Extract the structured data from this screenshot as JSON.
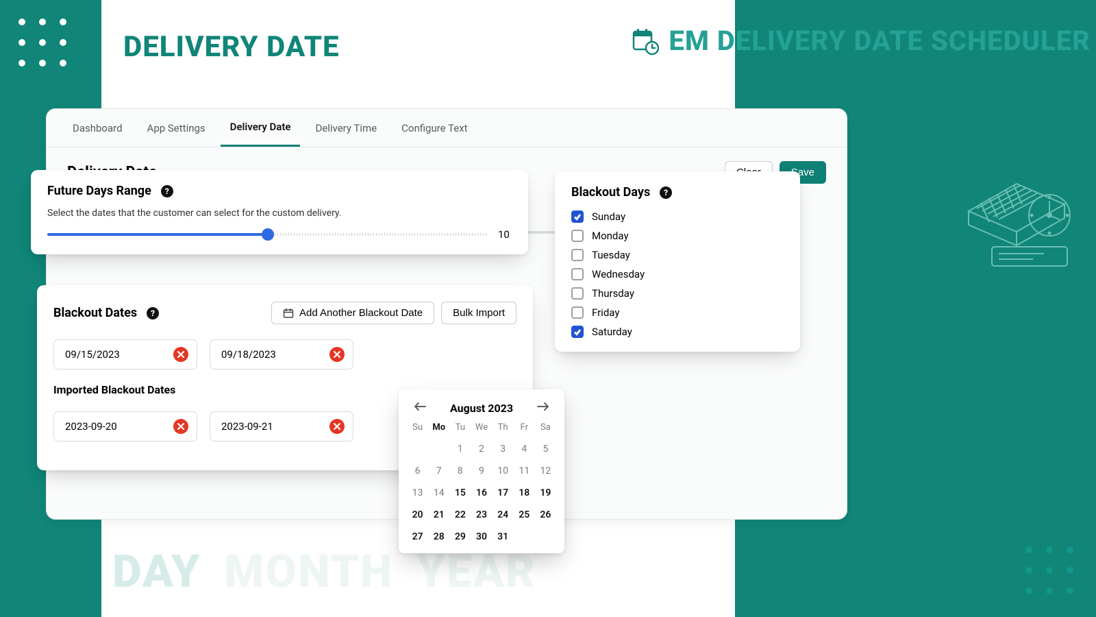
{
  "page_title": "DELIVERY DATE",
  "brand_title": "EM DELIVERY DATE SCHEDULER",
  "bg_words": {
    "day": "DAY",
    "month": "MONTH",
    "year": "YEAR"
  },
  "tabs": [
    {
      "label": "Dashboard"
    },
    {
      "label": "App Settings"
    },
    {
      "label": "Delivery Date",
      "active": true
    },
    {
      "label": "Delivery Time"
    },
    {
      "label": "Configure Text"
    }
  ],
  "section": {
    "title": "Delivery Date",
    "clear_label": "Clear",
    "save_label": "Save"
  },
  "bg_slider": {
    "value": 10,
    "fill_percent": 50
  },
  "range_card": {
    "title": "Future Days Range",
    "desc": "Select the dates that the customer can select for the custom delivery.",
    "value": 10,
    "fill_percent": 50
  },
  "blackout_card": {
    "title": "Blackout Dates",
    "add_label": "Add Another Blackout Date",
    "bulk_label": "Bulk Import",
    "dates": [
      "09/15/2023",
      "09/18/2023"
    ],
    "imported_title": "Imported Blackout Dates",
    "imported_dates": [
      "2023-09-20",
      "2023-09-21"
    ]
  },
  "calendar": {
    "month_label": "August 2023",
    "dows": [
      "Su",
      "Mo",
      "Tu",
      "We",
      "Th",
      "Fr",
      "Sa"
    ],
    "today_col_index": 1,
    "leading_blanks": 2,
    "days_in_month": 31,
    "unavailable_max": 14
  },
  "days_card": {
    "title": "Blackout Days",
    "days": [
      {
        "label": "Sunday",
        "checked": true
      },
      {
        "label": "Monday",
        "checked": false
      },
      {
        "label": "Tuesday",
        "checked": false
      },
      {
        "label": "Wednesday",
        "checked": false
      },
      {
        "label": "Thursday",
        "checked": false
      },
      {
        "label": "Friday",
        "checked": false
      },
      {
        "label": "Saturday",
        "checked": true
      }
    ]
  }
}
